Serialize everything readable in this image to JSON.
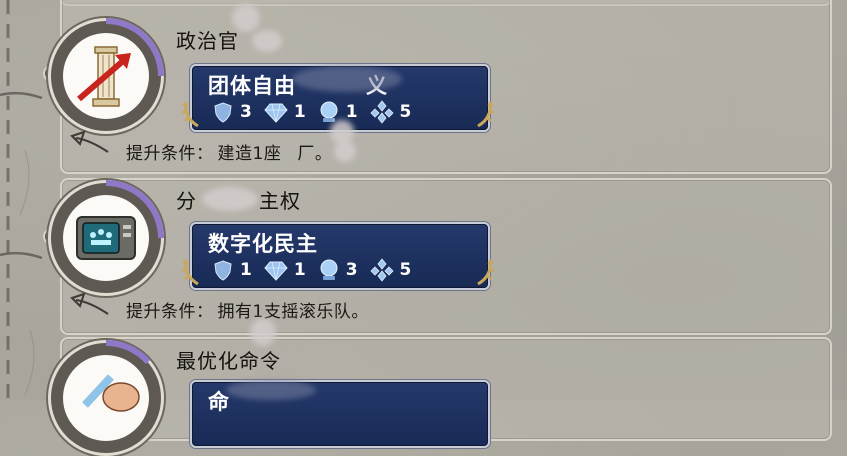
{
  "cards": [
    {
      "title": "政治官",
      "icon": "pillar-icon",
      "policy_name": "团体自由",
      "policy_suffix": "义",
      "stats": [
        {
          "icon": "shield-icon",
          "value": "3"
        },
        {
          "icon": "diamond-icon",
          "value": "1"
        },
        {
          "icon": "orb-icon",
          "value": "1"
        },
        {
          "icon": "cluster-icon",
          "value": "5"
        }
      ],
      "condition_label": "提升条件：",
      "condition_value": "建造1座",
      "condition_tail": "厂。",
      "progress": 0.3
    },
    {
      "title": "分",
      "title_tail": "主权",
      "icon": "tv-monitor-icon",
      "policy_name": "数字化民主",
      "stats": [
        {
          "icon": "shield-icon",
          "value": "1"
        },
        {
          "icon": "diamond-icon",
          "value": "1"
        },
        {
          "icon": "orb-icon",
          "value": "3"
        },
        {
          "icon": "cluster-icon",
          "value": "5"
        }
      ],
      "condition_label": "提升条件：",
      "condition_value": "拥有1支摇滚乐队。",
      "progress": 0.3
    },
    {
      "title": "最优化命令",
      "icon": "pen-hand-icon",
      "policy_name": "命",
      "progress": 0.2
    }
  ],
  "colors": {
    "panel_blue": "#1f3260",
    "progress_purple": "#8f78c8",
    "background": "#a9a59b"
  }
}
